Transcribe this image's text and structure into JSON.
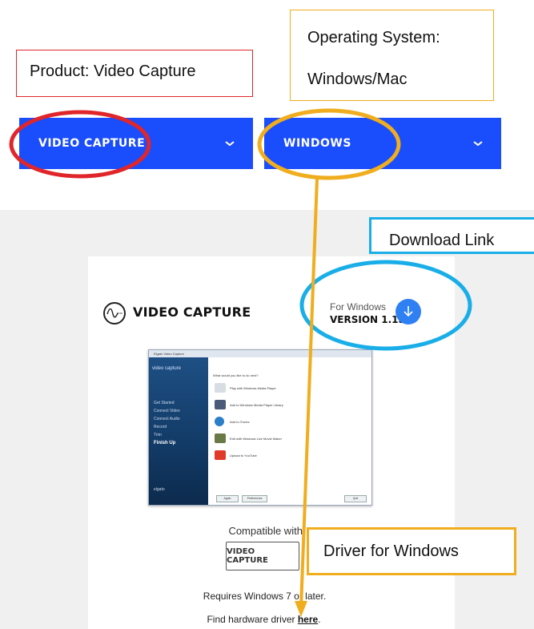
{
  "callouts": {
    "product": "Product: Video Capture",
    "os_line1": "Operating System:",
    "os_line2": "Windows/Mac",
    "download": "Download Link",
    "driver": "Driver for Windows"
  },
  "dropdowns": {
    "product": "VIDEO CAPTURE",
    "os": "WINDOWS"
  },
  "page": {
    "title": "VIDEO CAPTURE",
    "for_windows": "For Windows",
    "version": "VERSION 1.15",
    "compatible_with": "Compatible with:",
    "compat_badge": "VIDEO CAPTURE",
    "requirements": "Requires Windows 7 or later.",
    "find_prefix": "Find hardware driver ",
    "find_link": "here",
    "find_suffix": "."
  },
  "app": {
    "window_title": "Elgato Video Capture",
    "logo": "video capture",
    "sidebar": [
      "Get Started",
      "Connect Video",
      "Connect Audio",
      "Record",
      "Trim",
      "Finish Up"
    ],
    "brand": "elgato",
    "question": "What would you like to do next?",
    "options": [
      "Play with Windows Media Player",
      "Add to Windows Media Player Library",
      "Add to iTunes",
      "Edit with Windows Live Movie Maker",
      "Upload to YouTube"
    ],
    "buttons": [
      "Again",
      "Preferences",
      "Quit"
    ]
  },
  "colors": {
    "accent_blue": "#1a4dfb",
    "callout_red": "#e0262a",
    "callout_yellow": "#f0ad1e",
    "callout_cyan": "#1aaee8",
    "download_button": "#2f80f2"
  }
}
